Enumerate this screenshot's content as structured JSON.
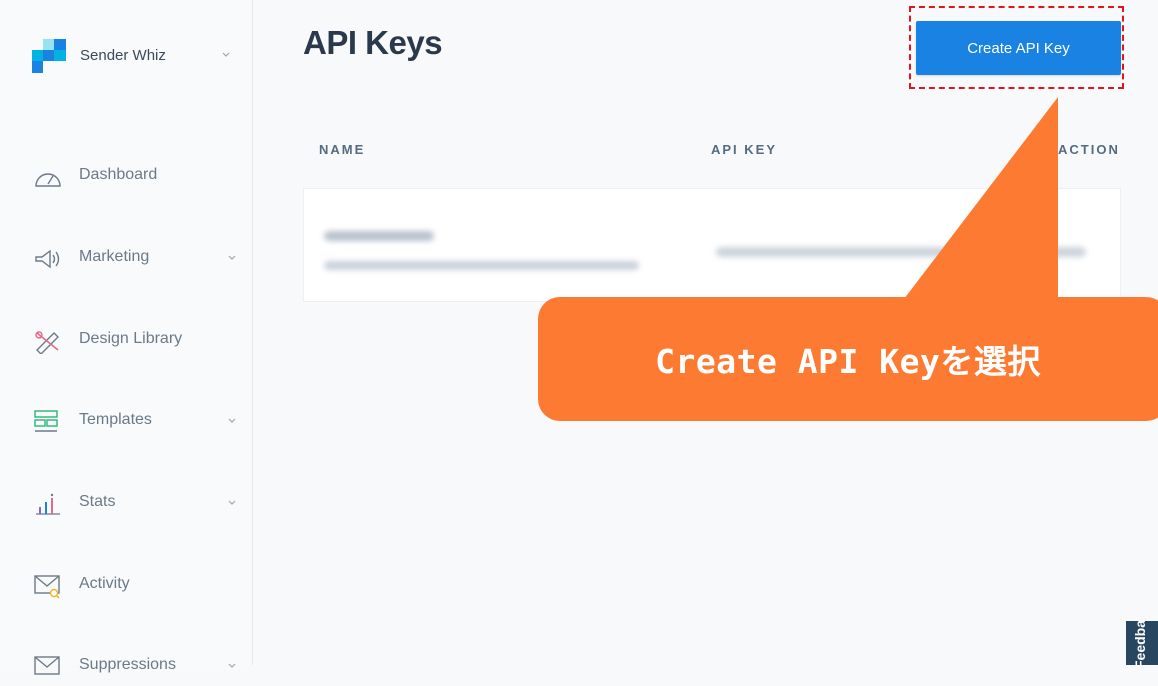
{
  "account": {
    "name": "Sender Whiz"
  },
  "nav": {
    "dashboard": "Dashboard",
    "marketing": "Marketing",
    "design_library": "Design Library",
    "templates": "Templates",
    "stats": "Stats",
    "activity": "Activity",
    "suppressions": "Suppressions"
  },
  "page": {
    "title": "API Keys",
    "create_button": "Create API Key"
  },
  "table": {
    "headers": {
      "name": "NAME",
      "api_key": "API KEY",
      "action": "ACTION"
    }
  },
  "callout": {
    "text": "Create API Keyを選択"
  },
  "feedback": {
    "label": "Feedback"
  },
  "colors": {
    "accent": "#1a82e2",
    "callout": "#fd7a33",
    "highlight": "#e0161f"
  }
}
